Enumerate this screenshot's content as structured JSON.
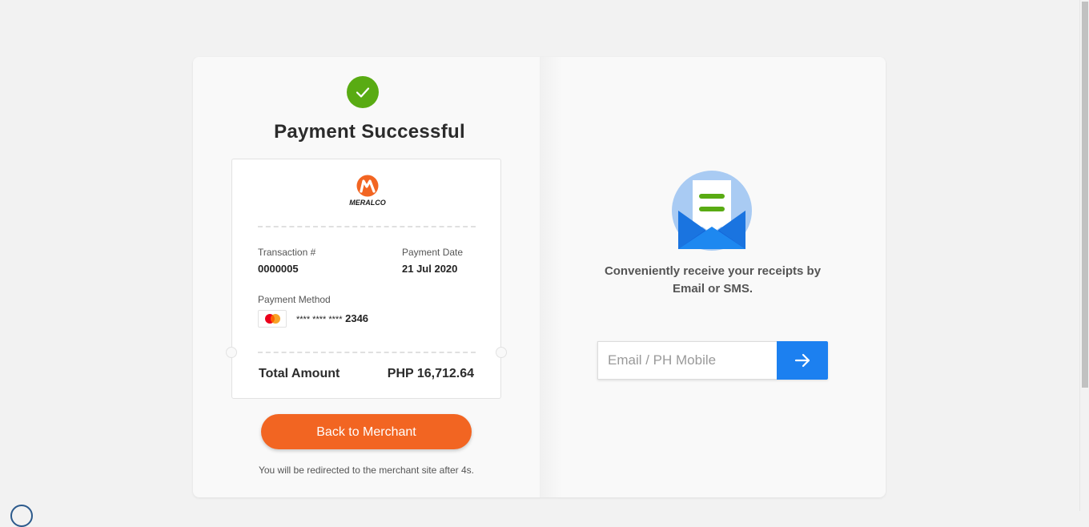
{
  "status": {
    "title": "Payment Successful",
    "icon": "checkmark-icon",
    "color": "#59ab13"
  },
  "merchant": {
    "logo_text": "MERALCO",
    "logo_color": "#f26522"
  },
  "receipt": {
    "transaction_label": "Transaction #",
    "transaction_value": "0000005",
    "date_label": "Payment Date",
    "date_value": "21 Jul 2020",
    "method_label": "Payment Method",
    "card_icon": "mastercard-icon",
    "card_masked": "**** **** ****",
    "card_last4": "2346",
    "total_label": "Total Amount",
    "total_value": "PHP 16,712.64"
  },
  "actions": {
    "back_label": "Back to Merchant",
    "back_color": "#f26522",
    "redirect_text": "You will be redirected to the merchant site after 4s."
  },
  "receipt_delivery": {
    "icon": "envelope-receipt-icon",
    "message_line1": "Conveniently receive your receipts by",
    "message_line2": "Email or SMS.",
    "input_placeholder": "Email / PH Mobile",
    "submit_icon": "arrow-right-icon",
    "submit_color": "#1c80f0"
  }
}
